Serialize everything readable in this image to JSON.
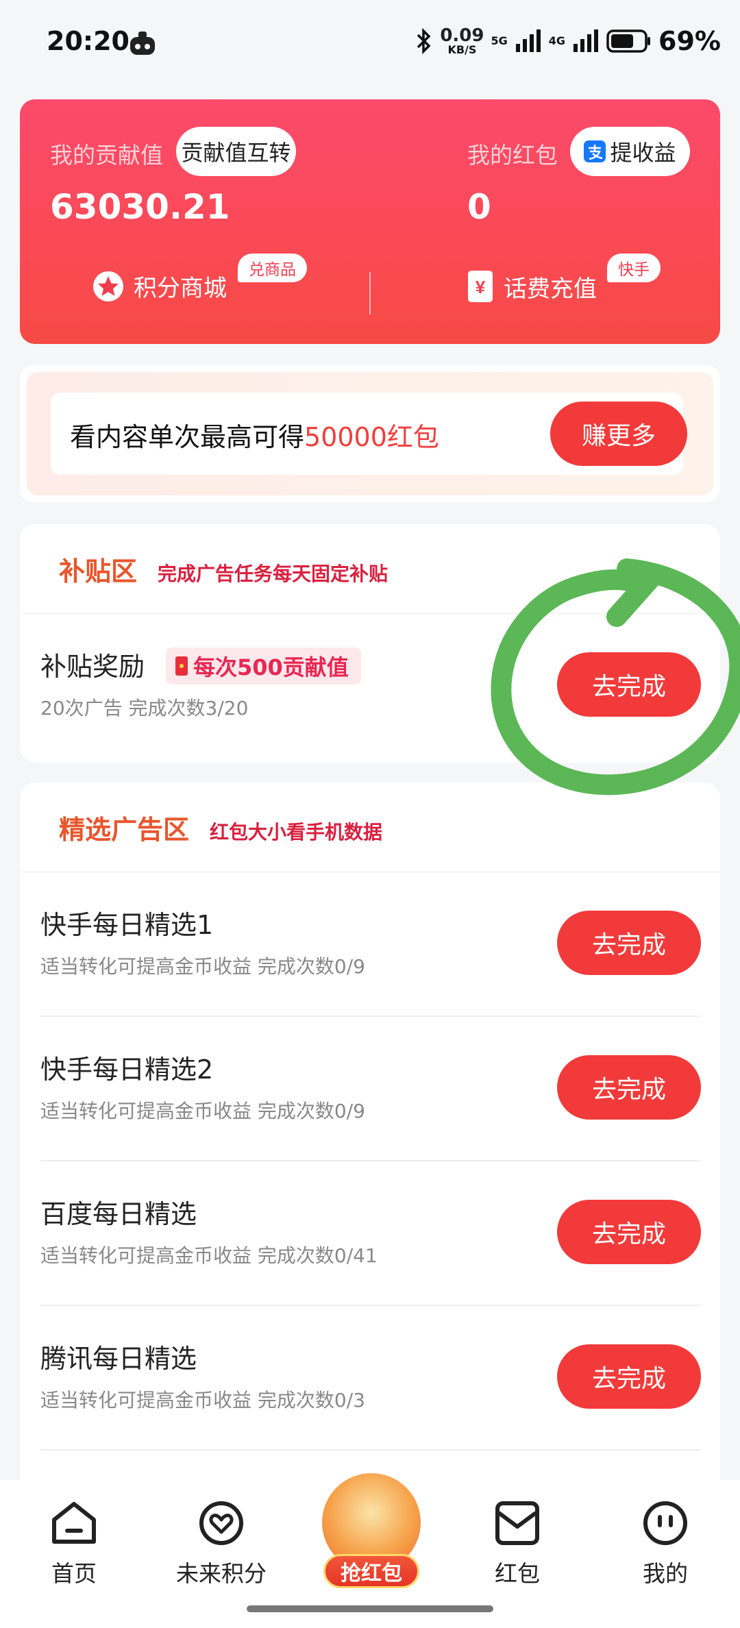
{
  "status_bar": {
    "time": "20:20",
    "net_speed": "0.09",
    "net_unit": "KB/S",
    "net1": "5G",
    "net2": "4G",
    "battery": "69%"
  },
  "top_card": {
    "contribution_label": "我的贡献值",
    "contribution_button": "贡献值互转",
    "contribution_value": "63030.21",
    "redpacket_label": "我的红包",
    "withdraw_button": "提收益",
    "redpacket_value": "0",
    "mall_label": "积分商城",
    "mall_badge": "兑商品",
    "recharge_label": "话费充值",
    "recharge_badge": "快手"
  },
  "promo": {
    "text_prefix": "看内容单次最高可得",
    "text_highlight": "50000红包",
    "button": "赚更多"
  },
  "subsidy": {
    "title": "补贴区",
    "subtitle": "完成广告任务每天固定补贴",
    "row": {
      "title": "补贴奖励",
      "tag": "每次500贡献值",
      "sub": "20次广告  完成次数3/20",
      "button": "去完成"
    }
  },
  "featured": {
    "title": "精选广告区",
    "subtitle": "红包大小看手机数据",
    "rows": [
      {
        "title": "快手每日精选1",
        "sub": "适当转化可提高金币收益  完成次数0/9",
        "button": "去完成"
      },
      {
        "title": "快手每日精选2",
        "sub": "适当转化可提高金币收益  完成次数0/9",
        "button": "去完成"
      },
      {
        "title": "百度每日精选",
        "sub": "适当转化可提高金币收益  完成次数0/41",
        "button": "去完成"
      },
      {
        "title": "腾讯每日精选",
        "sub": "适当转化可提高金币收益  完成次数0/3",
        "button": "去完成"
      }
    ]
  },
  "nav": {
    "home": "首页",
    "future_points": "未来积分",
    "grab": "抢红包",
    "redpacket": "红包",
    "mine": "我的"
  },
  "colors": {
    "accent_red": "#f23a3a",
    "section_title": "#e9552c",
    "section_sub": "#d9203f",
    "annotation_green": "#3faa3a"
  }
}
